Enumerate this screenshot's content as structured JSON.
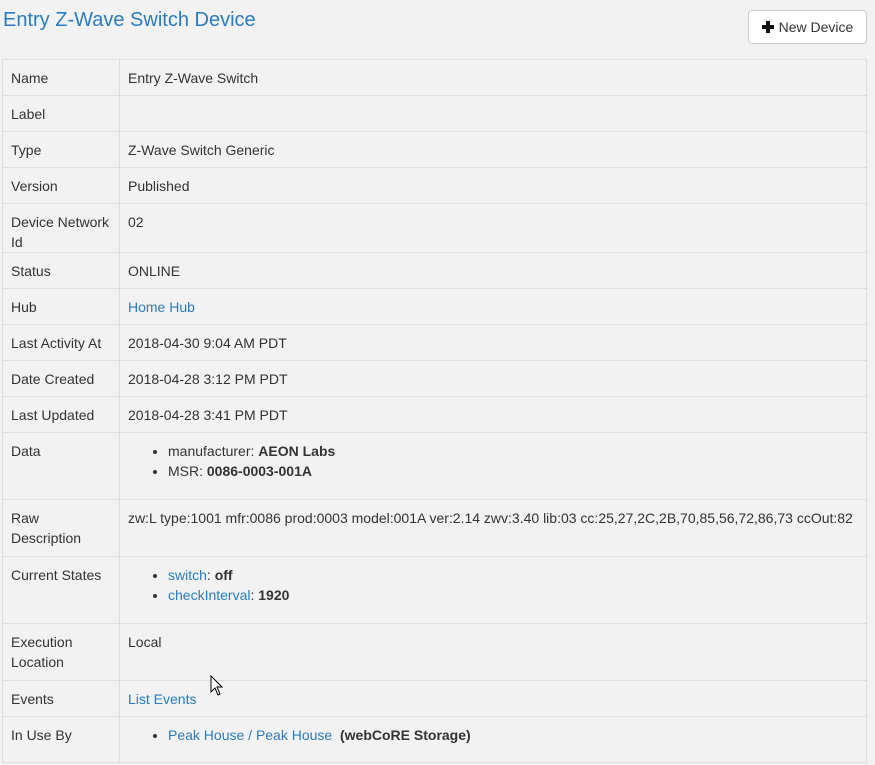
{
  "header": {
    "title": "Entry Z-Wave Switch Device",
    "new_device_label": "New Device"
  },
  "rows": {
    "name": {
      "label": "Name",
      "value": "Entry Z-Wave Switch"
    },
    "label": {
      "label": "Label",
      "value": ""
    },
    "type": {
      "label": "Type",
      "value": "Z-Wave Switch Generic"
    },
    "version": {
      "label": "Version",
      "value": "Published"
    },
    "dni": {
      "label": "Device Network Id",
      "value": "02"
    },
    "status": {
      "label": "Status",
      "value": "ONLINE"
    },
    "hub": {
      "label": "Hub",
      "value": "Home Hub"
    },
    "last_activity": {
      "label": "Last Activity At",
      "value": "2018-04-30 9:04 AM PDT"
    },
    "date_created": {
      "label": "Date Created",
      "value": "2018-04-28 3:12 PM PDT"
    },
    "last_updated": {
      "label": "Last Updated",
      "value": "2018-04-28 3:41 PM PDT"
    },
    "data": {
      "label": "Data",
      "items": [
        {
          "key": "manufacturer:",
          "value": "AEON Labs"
        },
        {
          "key": "MSR:",
          "value": "0086-0003-001A"
        }
      ]
    },
    "raw_description": {
      "label": "Raw Description",
      "value": "zw:L type:1001 mfr:0086 prod:0003 model:001A ver:2.14 zwv:3.40 lib:03 cc:25,27,2C,2B,70,85,56,72,86,73 ccOut:82"
    },
    "current_states": {
      "label": "Current States",
      "items": [
        {
          "key": "switch",
          "value": "off"
        },
        {
          "key": "checkInterval",
          "value": "1920"
        }
      ]
    },
    "execution_location": {
      "label": "Execution Location",
      "value": "Local"
    },
    "events": {
      "label": "Events",
      "link": "List Events"
    },
    "in_use_by": {
      "label": "In Use By",
      "link": "Peak House / Peak House",
      "note": "(webCoRE Storage)"
    }
  }
}
